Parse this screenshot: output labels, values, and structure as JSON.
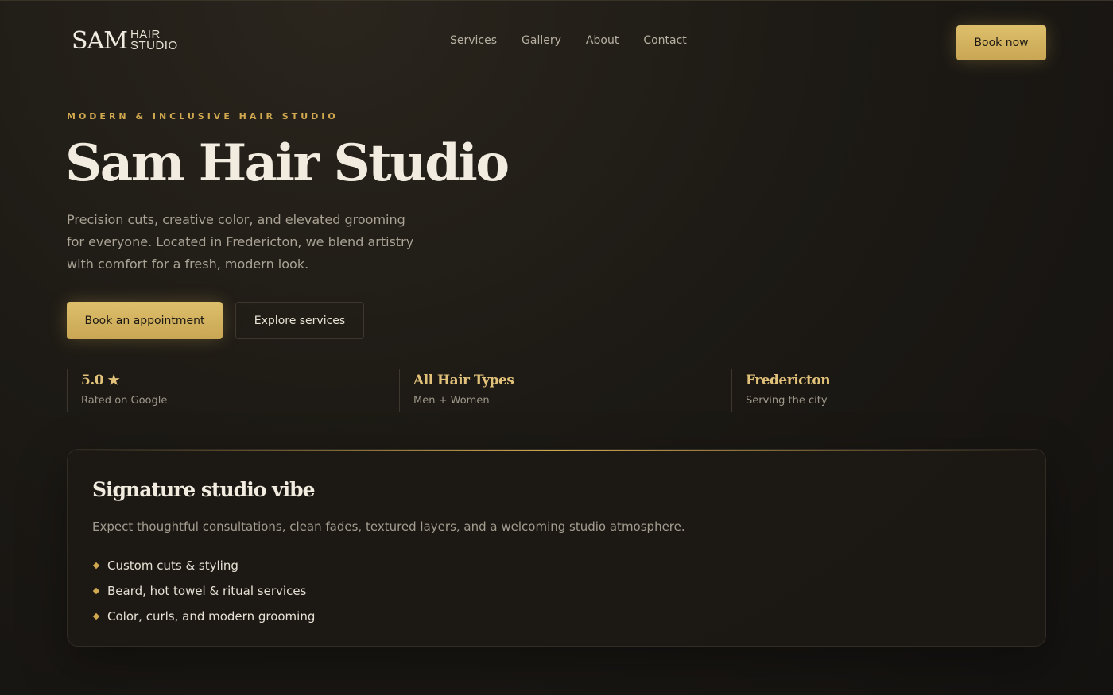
{
  "brand": {
    "mark": "SAM",
    "word1": "HAIR",
    "word2": "STUDIO"
  },
  "nav": [
    {
      "label": "Services"
    },
    {
      "label": "Gallery"
    },
    {
      "label": "About"
    },
    {
      "label": "Contact"
    }
  ],
  "header": {
    "book_now": "Book now"
  },
  "hero": {
    "eyebrow": "MODERN & INCLUSIVE HAIR STUDIO",
    "title": "Sam Hair Studio",
    "description": "Precision cuts, creative color, and elevated grooming for everyone. Located in Fredericton, we blend artistry with comfort for a fresh, modern look.",
    "primary_cta": "Book an appointment",
    "secondary_cta": "Explore services"
  },
  "stats": [
    {
      "value": "5.0 ★",
      "label": "Rated on Google"
    },
    {
      "value": "All Hair Types",
      "label": "Men + Women"
    },
    {
      "value": "Fredericton",
      "label": "Serving the city"
    }
  ],
  "card": {
    "title": "Signature studio vibe",
    "description": "Expect thoughtful consultations, clean fades, textured layers, and a welcoming studio atmosphere.",
    "items": [
      "Custom cuts & styling",
      "Beard, hot towel & ritual services",
      "Color, curls, and modern grooming"
    ]
  },
  "colors": {
    "accent": "#d0a84f",
    "background": "#1d1a15",
    "text": "#ece6da"
  }
}
